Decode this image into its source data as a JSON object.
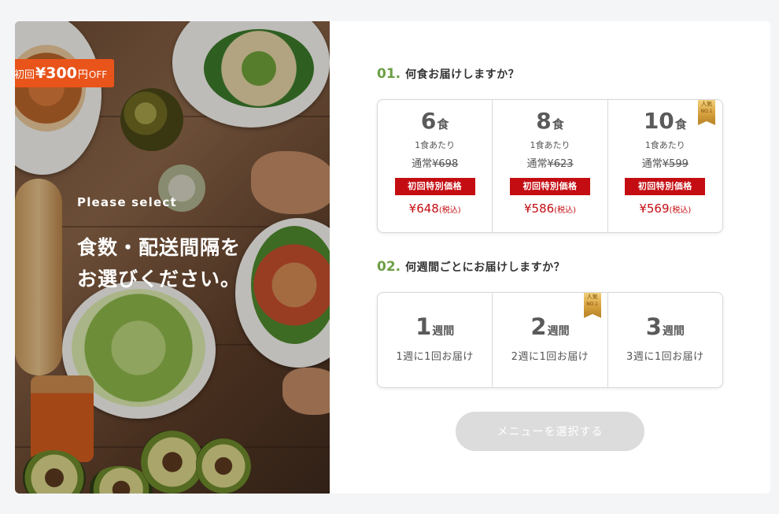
{
  "promo": {
    "prefix": "初回",
    "amount": "¥300",
    "unit": "円",
    "suffix": "OFF",
    "color": "#e8541a"
  },
  "hero": {
    "subtitle": "Please select",
    "title": "食数・配送間隔を\nお選びください。"
  },
  "q1": {
    "number": "01.",
    "text": "何食お届けしますか？"
  },
  "meals": [
    {
      "count": "6",
      "unit": "食",
      "per_label": "1食あたり",
      "regular_label": "通常",
      "regular_price": "¥698",
      "special_label": "初回特別価格",
      "price": "¥648",
      "tax": "(税込)",
      "badge": ""
    },
    {
      "count": "8",
      "unit": "食",
      "per_label": "1食あたり",
      "regular_label": "通常",
      "regular_price": "¥623",
      "special_label": "初回特別価格",
      "price": "¥586",
      "tax": "(税込)",
      "badge": ""
    },
    {
      "count": "10",
      "unit": "食",
      "per_label": "1食あたり",
      "regular_label": "通常",
      "regular_price": "¥599",
      "special_label": "初回特別価格",
      "price": "¥569",
      "tax": "(税込)",
      "badge": {
        "top": "人気",
        "bottom": "NO.1"
      }
    }
  ],
  "q2": {
    "number": "02.",
    "text": "何週間ごとにお届けしますか？"
  },
  "weeks": [
    {
      "count": "1",
      "unit": "週間",
      "desc": "1週に1回お届け",
      "badge": ""
    },
    {
      "count": "2",
      "unit": "週間",
      "desc": "2週に1回お届け",
      "badge": {
        "top": "人気",
        "bottom": "NO.1"
      }
    },
    {
      "count": "3",
      "unit": "週間",
      "desc": "3週に1回お届け",
      "badge": ""
    }
  ],
  "submit": {
    "label": "メニューを選択する",
    "disabled": true
  },
  "colors": {
    "accent_green": "#6d9f45",
    "price_red": "#c40d12",
    "promo_orange": "#e8541a",
    "button_disabled": "#dcdcdc"
  }
}
